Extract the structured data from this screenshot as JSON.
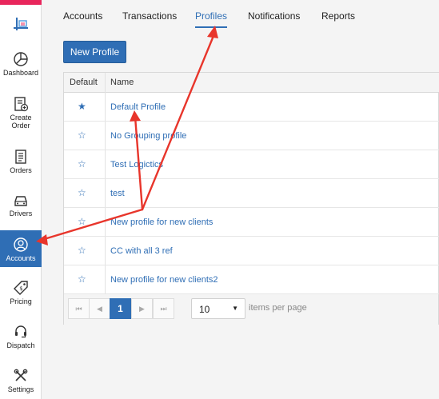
{
  "sidebar": {
    "logo_icon": "logo-icon",
    "items": [
      {
        "label": "Dashboard",
        "icon": "pie-chart-icon"
      },
      {
        "label_line1": "Create",
        "label_line2": "Order",
        "icon": "create-order-icon"
      },
      {
        "label": "Orders",
        "icon": "clipboard-icon"
      },
      {
        "label": "Drivers",
        "icon": "car-icon"
      },
      {
        "label": "Accounts",
        "icon": "user-circle-icon",
        "active": true
      },
      {
        "label": "Pricing",
        "icon": "price-tag-icon"
      },
      {
        "label": "Dispatch",
        "icon": "headset-icon"
      },
      {
        "label": "Settings",
        "icon": "wrench-icon"
      }
    ]
  },
  "tabs": [
    {
      "label": "Accounts"
    },
    {
      "label": "Transactions"
    },
    {
      "label": "Profiles",
      "active": true
    },
    {
      "label": "Notifications"
    },
    {
      "label": "Reports"
    }
  ],
  "toolbar": {
    "new_profile_label": "New Profile"
  },
  "grid": {
    "columns": [
      "Default",
      "Name"
    ],
    "rows": [
      {
        "default": true,
        "name": "Default Profile"
      },
      {
        "default": false,
        "name": "No Grouping profile"
      },
      {
        "default": false,
        "name": "Test Logictics"
      },
      {
        "default": false,
        "name": "test"
      },
      {
        "default": false,
        "name": "New profile for new clients"
      },
      {
        "default": false,
        "name": "CC with all 3 ref"
      },
      {
        "default": false,
        "name": "New profile for new clients2"
      }
    ]
  },
  "pager": {
    "first": "⏮",
    "prev": "◀",
    "current_page": "1",
    "next": "▶",
    "last": "⏭",
    "page_size": "10",
    "items_per_page_label": "items per page"
  },
  "colors": {
    "accent": "#2f6eb5",
    "annotation_arrow": "#e8352b",
    "brand_bar": "#e8265c"
  }
}
